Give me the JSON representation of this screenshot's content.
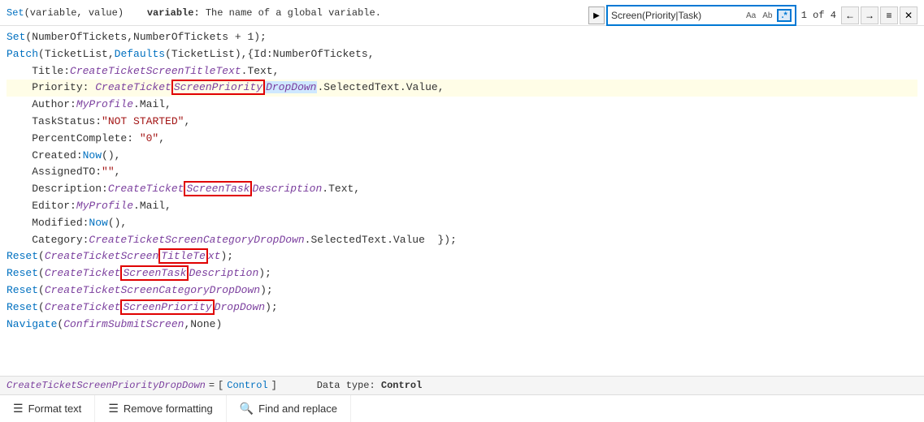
{
  "topbar": {
    "hint_func": "Set",
    "hint_params": "(variable, value)",
    "hint_sep": "variable:",
    "hint_desc": " The name of a global variable."
  },
  "search": {
    "value": "Screen(Priority|Task)",
    "opt_aa": "Aa",
    "opt_ab": "Ab",
    "count": "1 of 4",
    "btn_prev": "←",
    "btn_next": "→",
    "btn_lines": "≡",
    "btn_close": "✕"
  },
  "code": {
    "lines": [
      {
        "id": 1,
        "text": "Set(NumberOfTickets,NumberOfTickets + 1);"
      },
      {
        "id": 2,
        "text": "Patch(TicketList,Defaults(TicketList),{Id:NumberOfTickets,"
      },
      {
        "id": 3,
        "text": "    Title:CreateTicketScreenTitleText.Text,"
      },
      {
        "id": 4,
        "text": "    Priority: CreateTicketScreenPriorityDropDown.SelectedText.Value,",
        "highlight": true
      },
      {
        "id": 5,
        "text": "    Author:MyProfile.Mail,"
      },
      {
        "id": 6,
        "text": "    TaskStatus:\"NOT STARTED\","
      },
      {
        "id": 7,
        "text": "    PercentComplete: \"0\","
      },
      {
        "id": 8,
        "text": "    Created:Now(),"
      },
      {
        "id": 9,
        "text": "    AssignedTO:\"\","
      },
      {
        "id": 10,
        "text": "    Description:CreateTicketScreenTaskDescription.Text,"
      },
      {
        "id": 11,
        "text": "    Editor:MyProfile.Mail,"
      },
      {
        "id": 12,
        "text": "    Modified:Now(),"
      },
      {
        "id": 13,
        "text": "    Category:CreateTicketScreenCategoryDropDown.SelectedText.Value  });"
      },
      {
        "id": 14,
        "text": "Reset(CreateTicketScreenTitleText);"
      },
      {
        "id": 15,
        "text": "Reset(CreateTicketScreenTaskDescription);"
      },
      {
        "id": 16,
        "text": "Reset(CreateTicketScreenCategoryDropDown);"
      },
      {
        "id": 17,
        "text": "Reset(CreateTicketScreenPriorityDropDown);"
      },
      {
        "id": 18,
        "text": "Navigate(ConfirmSubmitScreen,None)"
      }
    ]
  },
  "statusbar": {
    "control_name": "CreateTicketScreenPriorityDropDown",
    "equals": " = ",
    "bracket_open": "[",
    "type": "Control",
    "bracket_close": "]",
    "datatype_label": "Data type:",
    "datatype_value": "Control"
  },
  "toolbar": {
    "format_text": "Format text",
    "remove_formatting": "Remove formatting",
    "find_replace": "Find and replace"
  }
}
